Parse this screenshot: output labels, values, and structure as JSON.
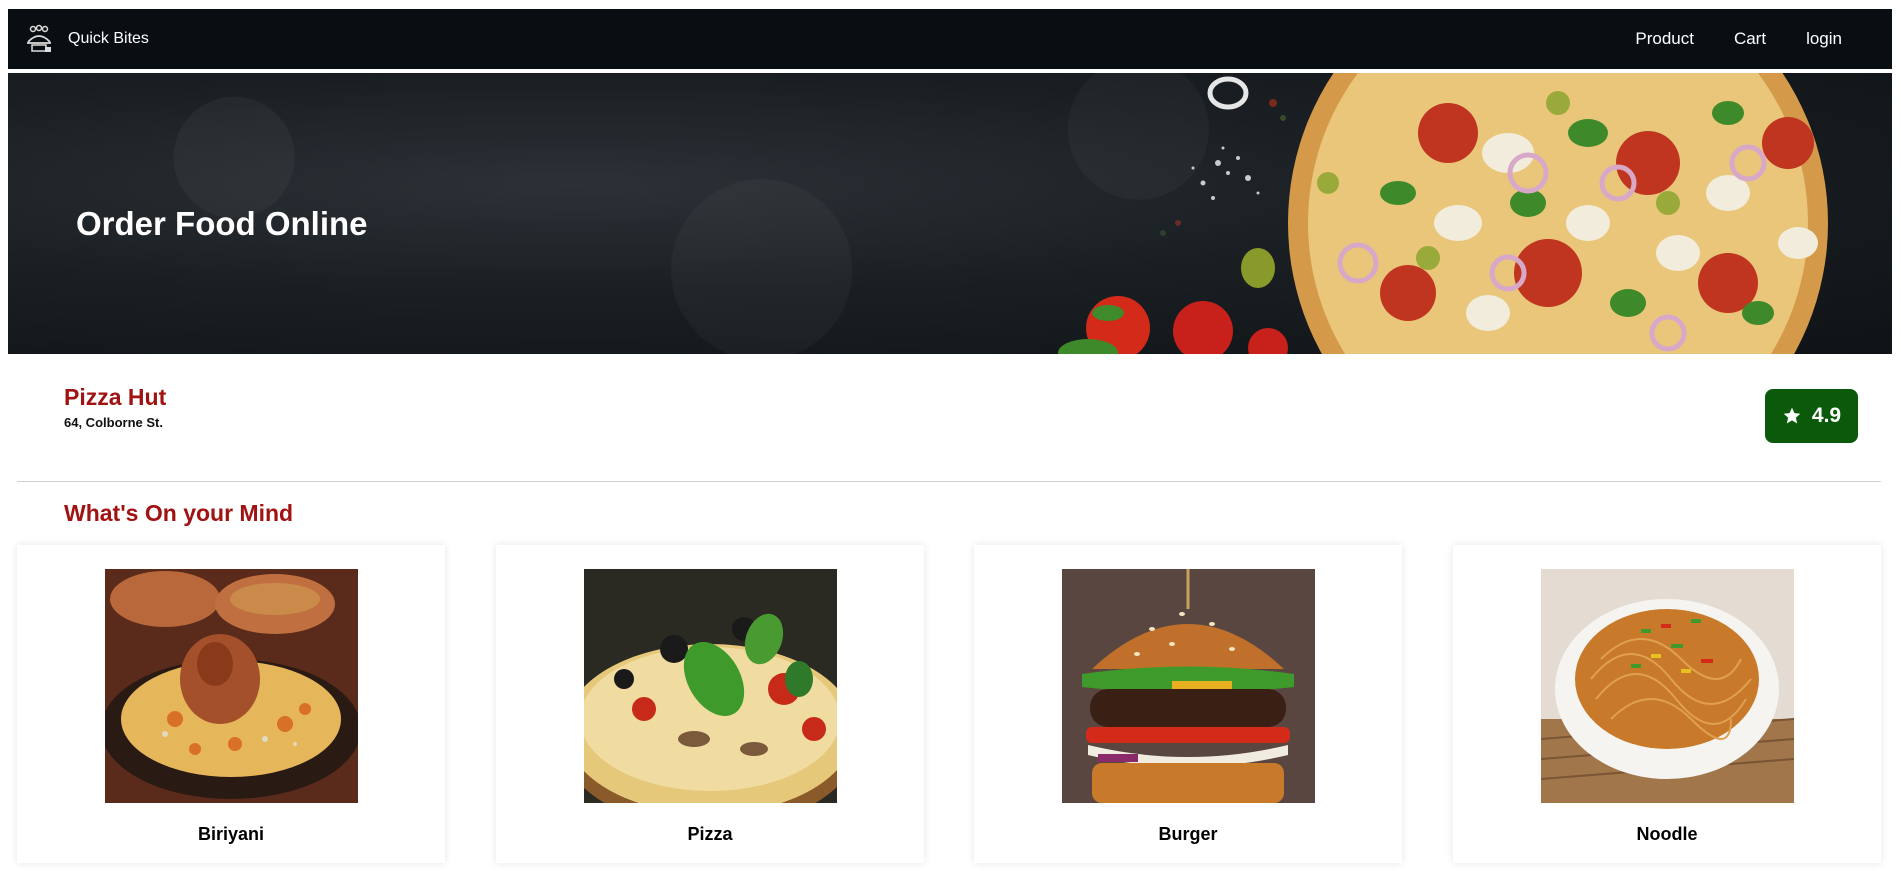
{
  "navbar": {
    "brand_name": "Quick Bites",
    "brand_icon": "chef-delivery-icon",
    "links": [
      {
        "label": "Product"
      },
      {
        "label": "Cart"
      },
      {
        "label": "login"
      }
    ]
  },
  "hero": {
    "title": "Order Food Online"
  },
  "restaurant": {
    "name": "Pizza Hut",
    "address": "64, Colborne St.",
    "rating": "4.9",
    "rating_icon": "star-icon"
  },
  "section": {
    "title": "What's On your Mind"
  },
  "categories": [
    {
      "label": "Biriyani",
      "icon": "biriyani-image"
    },
    {
      "label": "Pizza",
      "icon": "pizza-image"
    },
    {
      "label": "Burger",
      "icon": "burger-image"
    },
    {
      "label": "Noodle",
      "icon": "noodle-image"
    }
  ],
  "colors": {
    "navbar_bg": "#090e12",
    "accent_red": "#a11212",
    "rating_green": "#0b5a0b"
  }
}
